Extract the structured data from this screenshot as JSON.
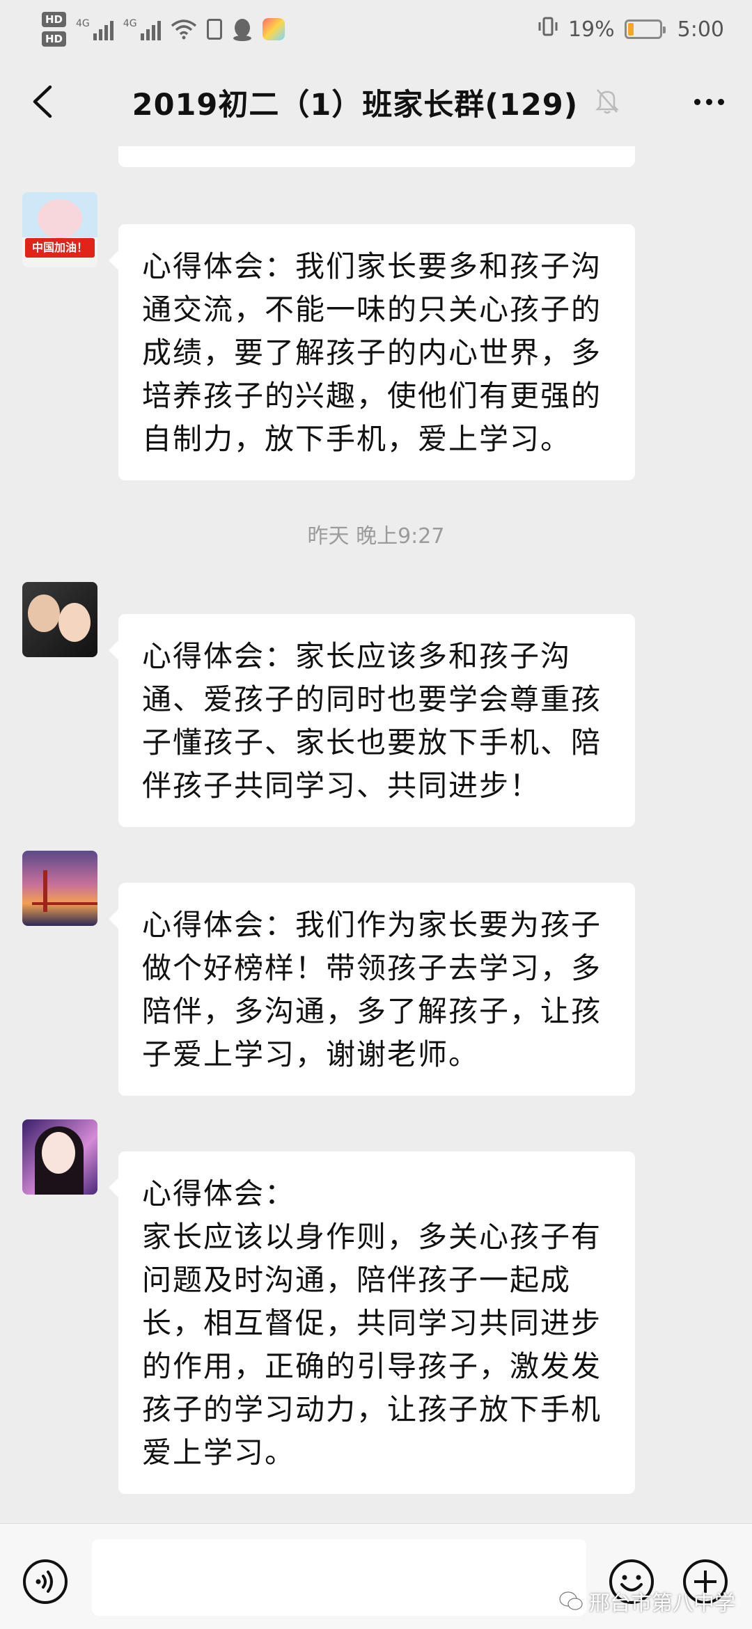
{
  "status_bar": {
    "hd1": "HD",
    "hd2": "HD",
    "sig1_label": "4G",
    "sig2_label": "4G",
    "battery_percent": "19%",
    "battery_level": 0.19,
    "time": "5:00"
  },
  "header": {
    "title": "2019初二（1）班家长群(129)"
  },
  "messages": [
    {
      "text": "心得体会：我们家长要多和孩子沟通交流，不能一味的只关心孩子的成绩，要了解孩子的内心世界，多培养孩子的兴趣，使他们有更强的自制力，放下手机，爱上学习。"
    },
    {
      "text": "心得体会：家长应该多和孩子沟通、爱孩子的同时也要学会尊重孩子懂孩子、家长也要放下手机、陪伴孩子共同学习、共同进步！"
    },
    {
      "text": "心得体会：我们作为家长要为孩子做个好榜样！带领孩子去学习，多陪伴，多沟通，多了解孩子，让孩子爱上学习，谢谢老师。"
    },
    {
      "line1": "心得体会：",
      "text": "家长应该以身作则，多关心孩子有问题及时沟通，陪伴孩子一起成长，相互督促，共同学习共同进步的作用，正确的引导孩子，激发发孩子的学习动力，让孩子放下手机爱上学习。"
    }
  ],
  "avatar1_banner": "中国加油！",
  "timestamp": "昨天 晚上9:27",
  "watermark": "邢台市第八中学",
  "colors": {
    "background": "#ededed",
    "bubble": "#ffffff",
    "battery": "#f5a623"
  }
}
